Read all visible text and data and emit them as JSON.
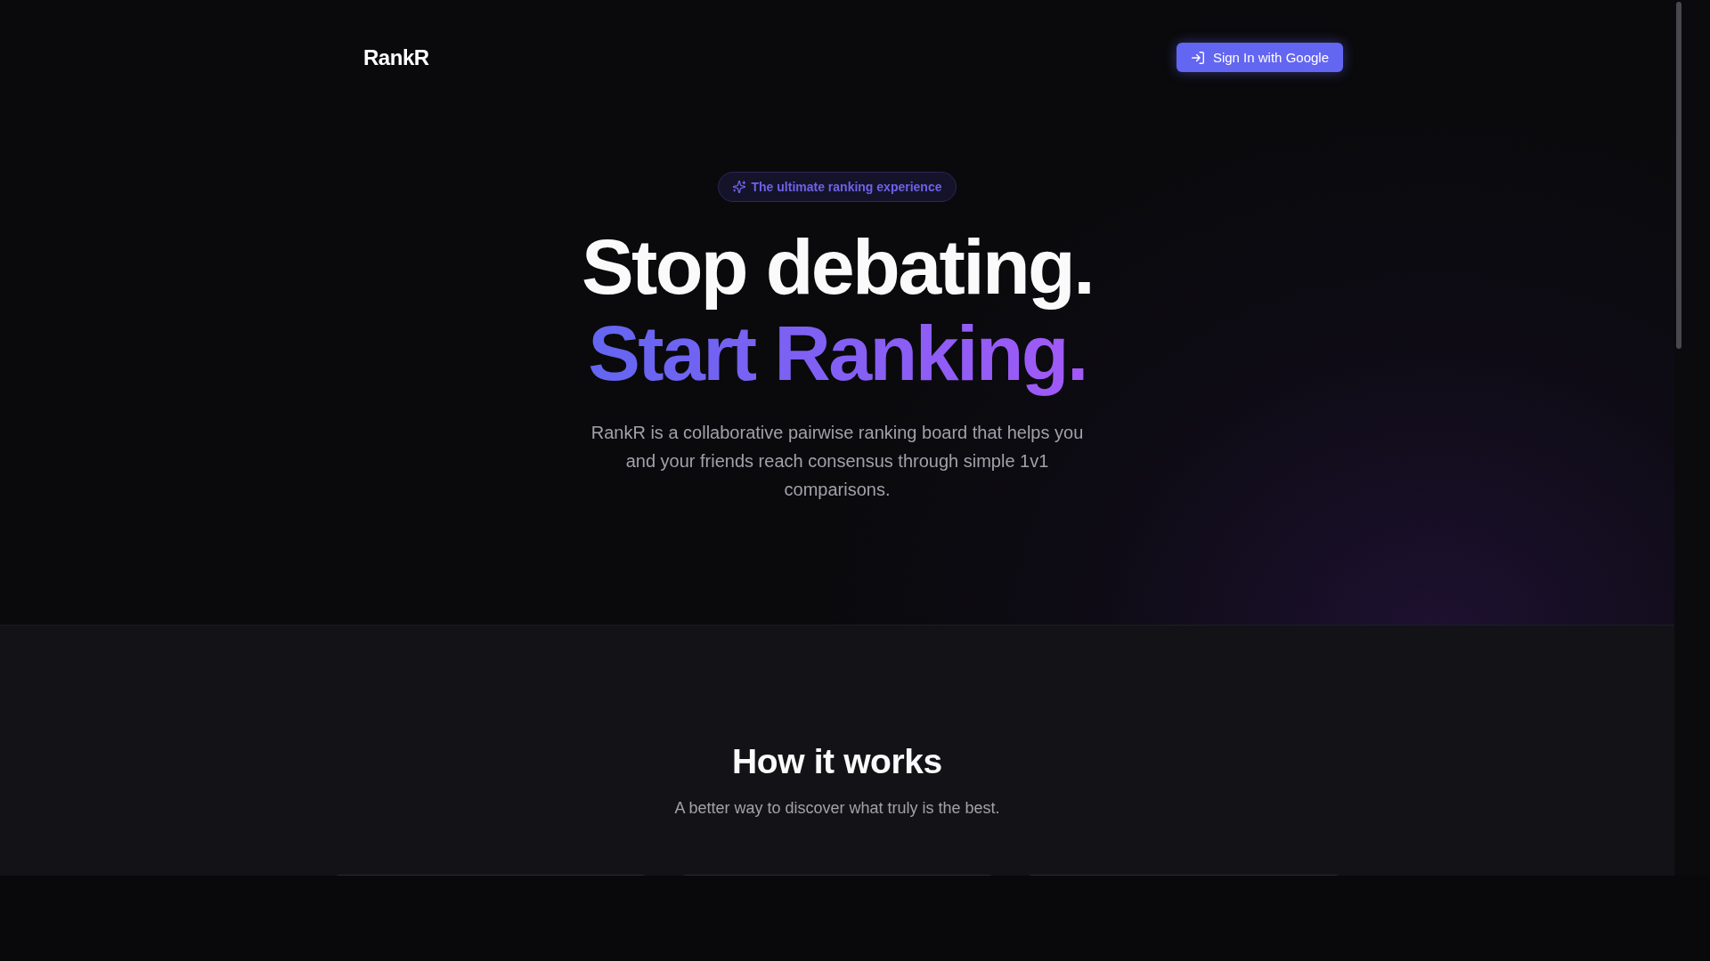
{
  "header": {
    "logo": "RankR",
    "sign_in_button": "Sign In with Google"
  },
  "hero": {
    "badge": "The ultimate ranking experience",
    "headline": [
      {
        "text": "Stop debating.",
        "kind": "plain"
      },
      {
        "text": "Start Ranking.",
        "kind": "gradient"
      }
    ],
    "description": "RankR is a collaborative pairwise ranking board that helps you and your friends reach consensus through simple 1v1 comparisons."
  },
  "how_it_works": {
    "title": "How it works",
    "subtitle": "A better way to discover what truly is the best."
  }
}
